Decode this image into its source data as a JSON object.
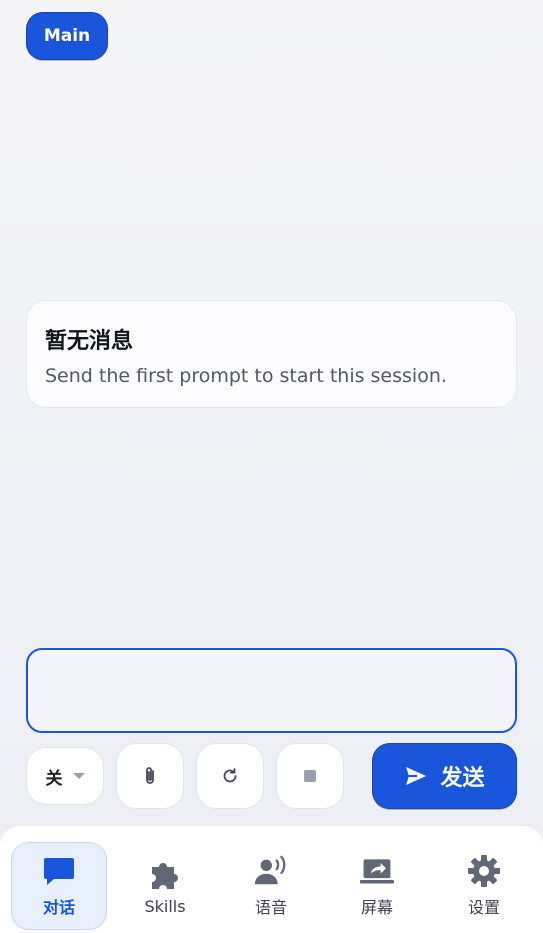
{
  "header": {
    "session_label": "Main"
  },
  "empty_state": {
    "title": "暂无消息",
    "subtitle": "Send the first prompt to start this session."
  },
  "composer": {
    "input_value": "",
    "placeholder": "",
    "mode_select": "关",
    "send_label": "发送",
    "accent_color": "#1a56db"
  },
  "tabs": [
    {
      "label": "对话",
      "icon": "chat-icon",
      "active": true
    },
    {
      "label": "Skills",
      "icon": "puzzle-icon",
      "active": false
    },
    {
      "label": "语音",
      "icon": "voice-icon",
      "active": false
    },
    {
      "label": "屏幕",
      "icon": "screen-share-icon",
      "active": false
    },
    {
      "label": "设置",
      "icon": "gear-icon",
      "active": false
    }
  ]
}
